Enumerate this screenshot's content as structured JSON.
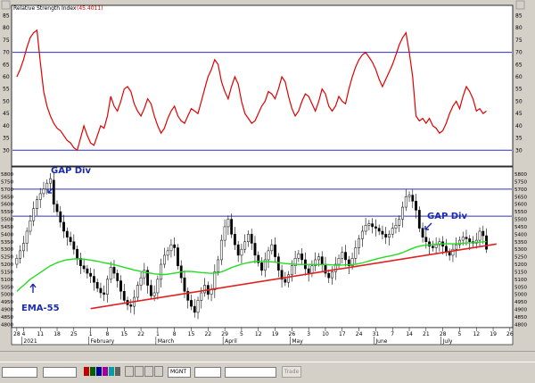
{
  "panel": {
    "title": "Relative Strength Index",
    "value": "(45.4011)"
  },
  "annotations": {
    "gap_left": "GAP Div",
    "gap_right": "GAP Div",
    "ema": "EMA-55"
  },
  "toolbar": {
    "symbol": "MGNT",
    "trade": "Trade"
  },
  "colors": {
    "rsi_line": "#e00000",
    "ema_line": "#22dd22",
    "trend_line": "#e02020",
    "level_lines": "#3030c0",
    "annotation": "#1a2bb0",
    "candle_up": "#ffffff",
    "candle_down": "#000000"
  },
  "chart_data": [
    {
      "type": "line",
      "name": "rsi",
      "title": "Relative Strength Index",
      "ylim": [
        25,
        87
      ],
      "yticks": [
        30,
        35,
        40,
        45,
        50,
        55,
        60,
        65,
        70,
        75,
        80,
        85
      ],
      "levels": [
        30,
        70
      ],
      "x": [
        0,
        1,
        2,
        3,
        4,
        5,
        6,
        7,
        8,
        9,
        10,
        11,
        12,
        13,
        14,
        15,
        16,
        17,
        18,
        19,
        20,
        21,
        22,
        23,
        24,
        25,
        26,
        27,
        28,
        29,
        30,
        31,
        32,
        33,
        34,
        35,
        36,
        37,
        38,
        39,
        40,
        41,
        42,
        43,
        44,
        45,
        46,
        47,
        48,
        49,
        50,
        51,
        52,
        53,
        54,
        55,
        56,
        57,
        58,
        59,
        60,
        61,
        62,
        63,
        64,
        65,
        66,
        67,
        68,
        69,
        70,
        71,
        72,
        73,
        74,
        75,
        76,
        77,
        78,
        79,
        80,
        81,
        82,
        83,
        84,
        85,
        86,
        87,
        88,
        89,
        90,
        91,
        92,
        93,
        94,
        95,
        96,
        97,
        98,
        99,
        100,
        101,
        102,
        103,
        104,
        105,
        106,
        107,
        108,
        109,
        110,
        111,
        112,
        113,
        114,
        115,
        116,
        117,
        118,
        119,
        120,
        121,
        122,
        123,
        124,
        125,
        126,
        127,
        128,
        129,
        130,
        131,
        132,
        133,
        134,
        135,
        136,
        137,
        138,
        139,
        140
      ],
      "values": [
        60,
        63,
        67,
        72,
        76,
        78,
        79,
        66,
        54,
        48,
        44,
        41,
        39,
        38,
        36,
        34,
        33,
        31,
        30,
        35,
        40,
        36,
        33,
        32,
        36,
        40,
        39,
        44,
        52,
        48,
        46,
        50,
        55,
        56,
        54,
        49,
        46,
        44,
        47,
        51,
        49,
        44,
        40,
        37,
        39,
        43,
        46,
        48,
        44,
        42,
        41,
        44,
        47,
        46,
        45,
        50,
        55,
        60,
        63,
        67,
        65,
        58,
        54,
        51,
        56,
        60,
        57,
        50,
        45,
        43,
        41,
        42,
        45,
        48,
        50,
        54,
        53,
        51,
        55,
        60,
        58,
        52,
        47,
        44,
        46,
        50,
        53,
        52,
        49,
        46,
        50,
        55,
        53,
        48,
        46,
        48,
        52,
        50,
        49,
        55,
        60,
        64,
        67,
        69,
        70,
        68,
        66,
        63,
        59,
        56,
        59,
        62,
        65,
        69,
        73,
        76,
        78,
        70,
        60,
        44,
        42,
        43,
        41,
        43,
        40,
        39,
        37,
        38,
        41,
        45,
        48,
        50,
        47,
        52,
        56,
        54,
        51,
        46,
        47,
        45,
        46
      ],
      "days_shown": 141
    },
    {
      "type": "candlestick",
      "name": "price",
      "ylim": [
        4790,
        5830
      ],
      "yticks": [
        4800,
        4850,
        4900,
        4950,
        5000,
        5050,
        5100,
        5150,
        5200,
        5250,
        5300,
        5350,
        5400,
        5450,
        5500,
        5550,
        5600,
        5650,
        5700,
        5750,
        5800
      ],
      "levels": [
        5700,
        5520
      ],
      "close": [
        5240,
        5290,
        5340,
        5420,
        5490,
        5570,
        5630,
        5670,
        5700,
        5740,
        5770,
        5600,
        5550,
        5480,
        5420,
        5380,
        5350,
        5300,
        5240,
        5190,
        5170,
        5140,
        5120,
        5080,
        5040,
        5010,
        5000,
        5100,
        5180,
        5140,
        5090,
        5020,
        4960,
        4930,
        4920,
        4980,
        5060,
        5110,
        5160,
        5060,
        4990,
        5010,
        5100,
        5200,
        5260,
        5290,
        5330,
        5310,
        5190,
        5110,
        5020,
        4960,
        4920,
        4880,
        4960,
        5010,
        5060,
        5000,
        5030,
        5150,
        5230,
        5360,
        5450,
        5500,
        5400,
        5330,
        5260,
        5300,
        5350,
        5400,
        5340,
        5260,
        5210,
        5160,
        5230,
        5290,
        5330,
        5250,
        5160,
        5100,
        5080,
        5130,
        5190,
        5240,
        5270,
        5230,
        5170,
        5140,
        5190,
        5230,
        5250,
        5200,
        5140,
        5110,
        5150,
        5200,
        5240,
        5280,
        5230,
        5190,
        5240,
        5310,
        5370,
        5420,
        5460,
        5470,
        5450,
        5440,
        5420,
        5400,
        5380,
        5400,
        5440,
        5460,
        5500,
        5580,
        5650,
        5660,
        5620,
        5560,
        5440,
        5380,
        5350,
        5320,
        5310,
        5330,
        5350,
        5320,
        5280,
        5260,
        5300,
        5330,
        5360,
        5380,
        5370,
        5350,
        5340,
        5360,
        5420,
        5390,
        5300
      ],
      "open": [
        5200,
        5240,
        5290,
        5340,
        5420,
        5490,
        5570,
        5630,
        5670,
        5700,
        5740,
        5760,
        5600,
        5550,
        5480,
        5420,
        5380,
        5350,
        5300,
        5240,
        5190,
        5170,
        5140,
        5120,
        5080,
        5040,
        5010,
        5000,
        5100,
        5180,
        5140,
        5090,
        5020,
        4960,
        4930,
        4920,
        4980,
        5060,
        5110,
        5160,
        5060,
        4990,
        5010,
        5100,
        5200,
        5260,
        5290,
        5330,
        5310,
        5190,
        5110,
        5020,
        4960,
        4920,
        4880,
        4960,
        5010,
        5060,
        5000,
        5030,
        5150,
        5230,
        5360,
        5450,
        5500,
        5400,
        5330,
        5260,
        5300,
        5350,
        5400,
        5340,
        5260,
        5210,
        5160,
        5230,
        5290,
        5330,
        5250,
        5160,
        5100,
        5080,
        5130,
        5190,
        5240,
        5270,
        5230,
        5170,
        5140,
        5190,
        5230,
        5250,
        5200,
        5140,
        5110,
        5150,
        5200,
        5240,
        5280,
        5230,
        5190,
        5240,
        5310,
        5370,
        5420,
        5460,
        5470,
        5450,
        5440,
        5420,
        5400,
        5380,
        5400,
        5440,
        5460,
        5500,
        5580,
        5650,
        5660,
        5620,
        5560,
        5440,
        5380,
        5350,
        5320,
        5310,
        5330,
        5350,
        5320,
        5280,
        5260,
        5300,
        5330,
        5360,
        5380,
        5370,
        5350,
        5340,
        5360,
        5420,
        5390
      ],
      "ema55": [
        5020,
        5040,
        5060,
        5080,
        5100,
        5115,
        5130,
        5145,
        5160,
        5175,
        5190,
        5200,
        5210,
        5218,
        5225,
        5230,
        5233,
        5235,
        5236,
        5236,
        5234,
        5231,
        5228,
        5224,
        5220,
        5215,
        5210,
        5206,
        5202,
        5197,
        5192,
        5186,
        5180,
        5174,
        5168,
        5162,
        5157,
        5152,
        5148,
        5144,
        5140,
        5136,
        5134,
        5132,
        5132,
        5134,
        5137,
        5141,
        5145,
        5149,
        5152,
        5153,
        5152,
        5150,
        5147,
        5145,
        5143,
        5141,
        5140,
        5141,
        5144,
        5150,
        5158,
        5168,
        5178,
        5186,
        5193,
        5200,
        5206,
        5211,
        5215,
        5218,
        5219,
        5219,
        5218,
        5217,
        5216,
        5214,
        5211,
        5208,
        5205,
        5203,
        5201,
        5200,
        5199,
        5199,
        5199,
        5199,
        5198,
        5198,
        5198,
        5198,
        5198,
        5197,
        5196,
        5195,
        5195,
        5195,
        5196,
        5197,
        5198,
        5200,
        5204,
        5209,
        5215,
        5222,
        5228,
        5234,
        5240,
        5245,
        5250,
        5254,
        5259,
        5264,
        5270,
        5278,
        5287,
        5297,
        5306,
        5314,
        5320,
        5324,
        5327,
        5329,
        5331,
        5333,
        5335,
        5336,
        5336,
        5336,
        5336,
        5337,
        5338,
        5340,
        5342,
        5343,
        5344,
        5345,
        5347,
        5350,
        5351
      ],
      "trendline": [
        [
          22,
          4905
        ],
        [
          136,
          5310
        ]
      ],
      "days_shown": 141,
      "xticks": [
        {
          "day": 0,
          "label": "28"
        },
        {
          "day": 2,
          "label": "4"
        },
        {
          "day": 7,
          "label": "11"
        },
        {
          "day": 12,
          "label": "18"
        },
        {
          "day": 17,
          "label": "25"
        },
        {
          "day": 22,
          "label": "1"
        },
        {
          "day": 27,
          "label": "8"
        },
        {
          "day": 32,
          "label": "15"
        },
        {
          "day": 37,
          "label": "22"
        },
        {
          "day": 42,
          "label": "1"
        },
        {
          "day": 47,
          "label": "8"
        },
        {
          "day": 52,
          "label": "15"
        },
        {
          "day": 57,
          "label": "22"
        },
        {
          "day": 62,
          "label": "29"
        },
        {
          "day": 67,
          "label": "5"
        },
        {
          "day": 72,
          "label": "12"
        },
        {
          "day": 77,
          "label": "19"
        },
        {
          "day": 82,
          "label": "26"
        },
        {
          "day": 87,
          "label": "3"
        },
        {
          "day": 92,
          "label": "10"
        },
        {
          "day": 97,
          "label": "17"
        },
        {
          "day": 102,
          "label": "24"
        },
        {
          "day": 107,
          "label": "31"
        },
        {
          "day": 112,
          "label": "7"
        },
        {
          "day": 117,
          "label": "14"
        },
        {
          "day": 122,
          "label": "21"
        },
        {
          "day": 127,
          "label": "28"
        },
        {
          "day": 132,
          "label": "5"
        },
        {
          "day": 137,
          "label": "12"
        },
        {
          "day": 142,
          "label": "19"
        },
        {
          "day": 147,
          "label": "26"
        }
      ],
      "month_labels": [
        {
          "day": 2,
          "label": "2021"
        },
        {
          "day": 22,
          "label": "February"
        },
        {
          "day": 42,
          "label": "March"
        },
        {
          "day": 62,
          "label": "April"
        },
        {
          "day": 82,
          "label": "May"
        },
        {
          "day": 107,
          "label": "June"
        },
        {
          "day": 127,
          "label": "July"
        }
      ]
    }
  ]
}
